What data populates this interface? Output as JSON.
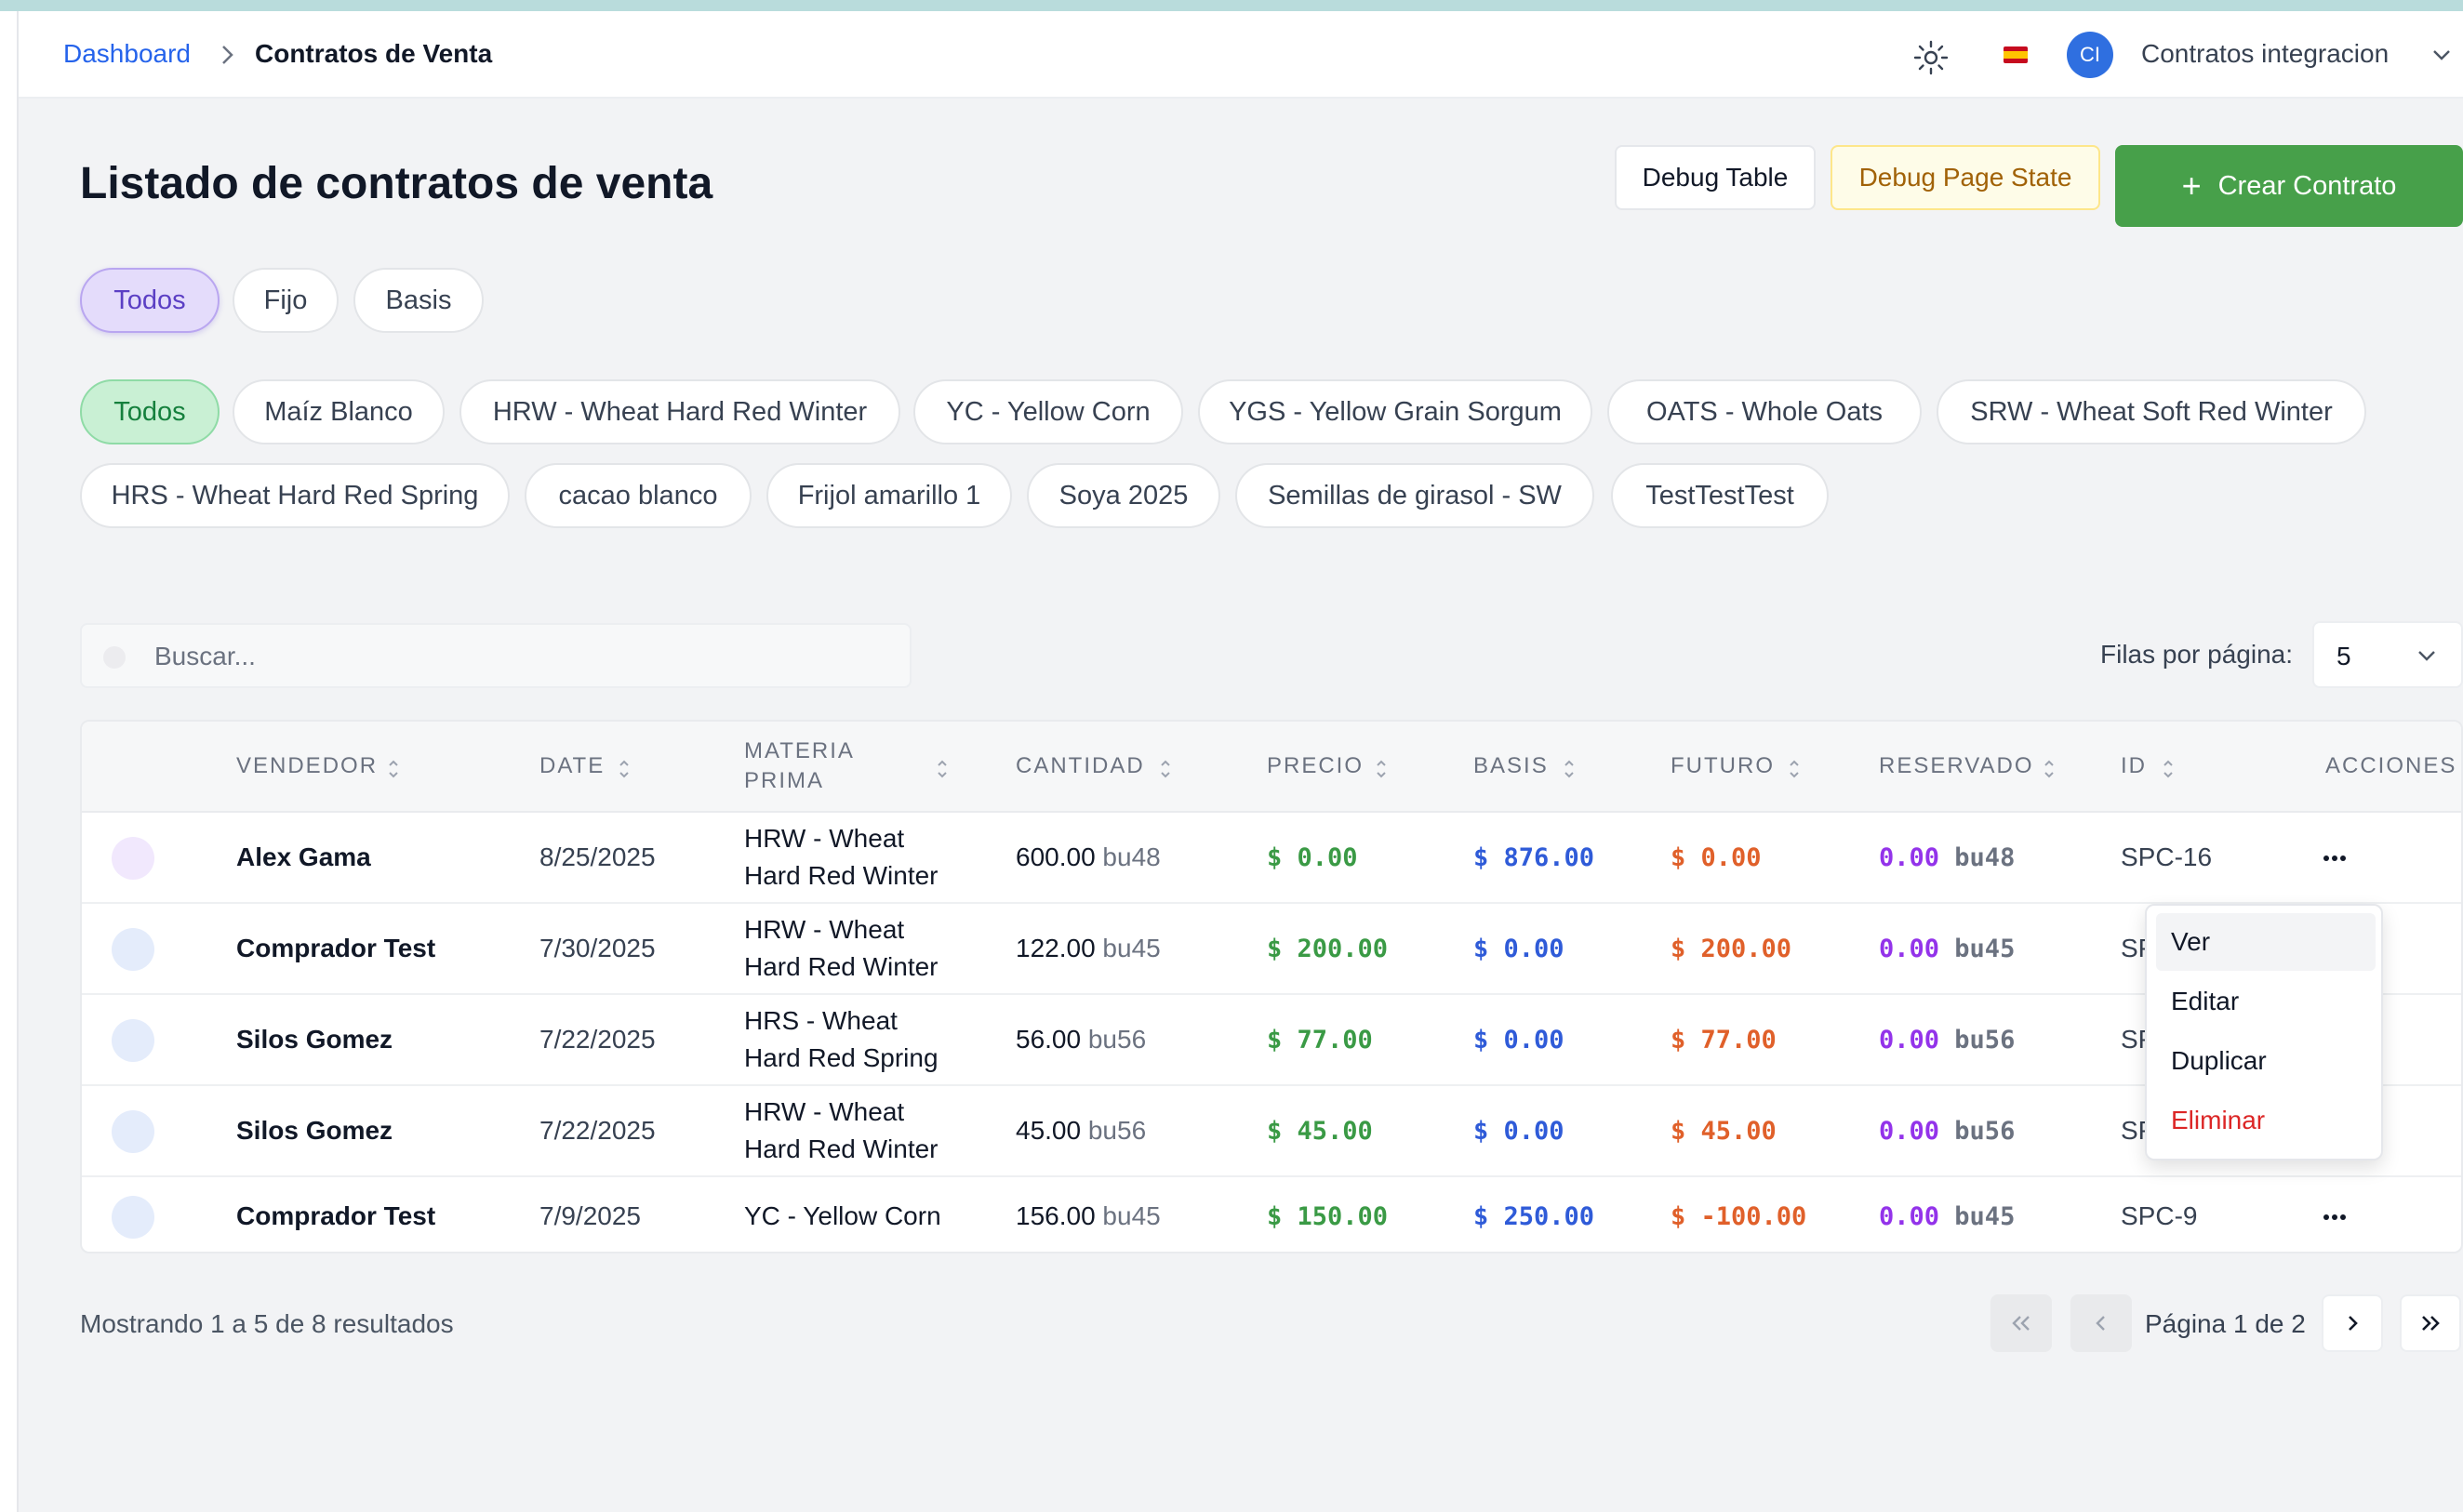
{
  "breadcrumb": {
    "home": "Dashboard",
    "current": "Contratos de Venta"
  },
  "user": {
    "initials": "CI",
    "name": "Contratos integracion",
    "avatar_color": "#2f6fe0"
  },
  "page": {
    "title": "Listado de contratos de venta",
    "debug_table": "Debug Table",
    "debug_state": "Debug Page State",
    "create": "Crear Contrato"
  },
  "type_filters": [
    "Todos",
    "Fijo",
    "Basis"
  ],
  "product_filters": [
    "Todos",
    "Maíz Blanco",
    "HRW - Wheat Hard Red Winter",
    "YC - Yellow Corn",
    "YGS - Yellow Grain Sorgum",
    "OATS - Whole Oats",
    "SRW - Wheat Soft Red Winter",
    "HRS - Wheat Hard Red Spring",
    "cacao blanco",
    "Frijol amarillo 1",
    "Soya 2025",
    "Semillas de girasol - SW",
    "TestTestTest"
  ],
  "search": {
    "placeholder": "Buscar..."
  },
  "rows_per_page": {
    "label": "Filas por página:",
    "value": "5"
  },
  "columns": {
    "vendedor": "VENDEDOR",
    "date": "DATE",
    "materia_1": "MATERIA",
    "materia_2": "PRIMA",
    "cantidad": "CANTIDAD",
    "precio": "PRECIO",
    "basis": "BASIS",
    "futuro": "FUTURO",
    "reservado": "RESERVADO",
    "id": "ID",
    "acciones": "ACCIONES"
  },
  "rows": [
    {
      "vendor": "Alex Gama",
      "date": "8/25/2025",
      "material": "HRW - Wheat Hard Red Winter",
      "qty": "600.00",
      "unit": "bu48",
      "precio": "$ 0.00",
      "basis": "$ 876.00",
      "futuro": "$ 0.00",
      "reservado": "0.00",
      "res_unit": "bu48",
      "id": "SPC-16"
    },
    {
      "vendor": "Comprador Test",
      "date": "7/30/2025",
      "material": "HRW - Wheat Hard Red Winter",
      "qty": "122.00",
      "unit": "bu45",
      "precio": "$ 200.00",
      "basis": "$ 0.00",
      "futuro": "$ 200.00",
      "reservado": "0.00",
      "res_unit": "bu45",
      "id": "SP"
    },
    {
      "vendor": "Silos Gomez",
      "date": "7/22/2025",
      "material": "HRS - Wheat Hard Red Spring",
      "qty": "56.00",
      "unit": "bu56",
      "precio": "$ 77.00",
      "basis": "$ 0.00",
      "futuro": "$ 77.00",
      "reservado": "0.00",
      "res_unit": "bu56",
      "id": "SP"
    },
    {
      "vendor": "Silos Gomez",
      "date": "7/22/2025",
      "material": "HRW - Wheat Hard Red Winter",
      "qty": "45.00",
      "unit": "bu56",
      "precio": "$ 45.00",
      "basis": "$ 0.00",
      "futuro": "$ 45.00",
      "reservado": "0.00",
      "res_unit": "bu56",
      "id": "SP"
    },
    {
      "vendor": "Comprador Test",
      "date": "7/9/2025",
      "material": "YC - Yellow Corn",
      "qty": "156.00",
      "unit": "bu45",
      "precio": "$ 150.00",
      "basis": "$ 250.00",
      "futuro": "$ -100.00",
      "reservado": "0.00",
      "res_unit": "bu45",
      "id": "SPC-9"
    }
  ],
  "menu": [
    "Ver",
    "Editar",
    "Duplicar",
    "Eliminar"
  ],
  "footer": {
    "showing": "Mostrando 1 a 5 de 8 resultados",
    "page": "Página 1 de 2"
  },
  "colors": {
    "green": "#3a9a45",
    "blue": "#2f5bd8",
    "orange": "#e0602a",
    "purple": "#9333ea",
    "create": "#47a04a"
  }
}
